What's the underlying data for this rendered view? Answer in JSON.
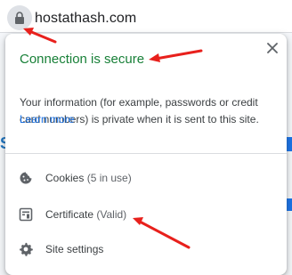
{
  "address_bar": {
    "url": "hostathash.com",
    "lock_icon": "lock-icon"
  },
  "popup": {
    "title": "Connection is secure",
    "description": "Your information (for example, passwords or credit card numbers) is private when it is sent to this site.",
    "learn_more": "Learn more",
    "close_icon": "close-icon",
    "items": [
      {
        "icon": "cookie-icon",
        "label": "Cookies",
        "sub": "(5 in use)"
      },
      {
        "icon": "certificate-icon",
        "label": "Certificate",
        "sub": "(Valid)"
      },
      {
        "icon": "gear-icon",
        "label": "Site settings",
        "sub": ""
      }
    ]
  },
  "background_page": {
    "partial_letter": "S"
  },
  "colors": {
    "secure_green": "#188038",
    "link_blue": "#1a73e8",
    "annotation_red": "#e8201c"
  }
}
